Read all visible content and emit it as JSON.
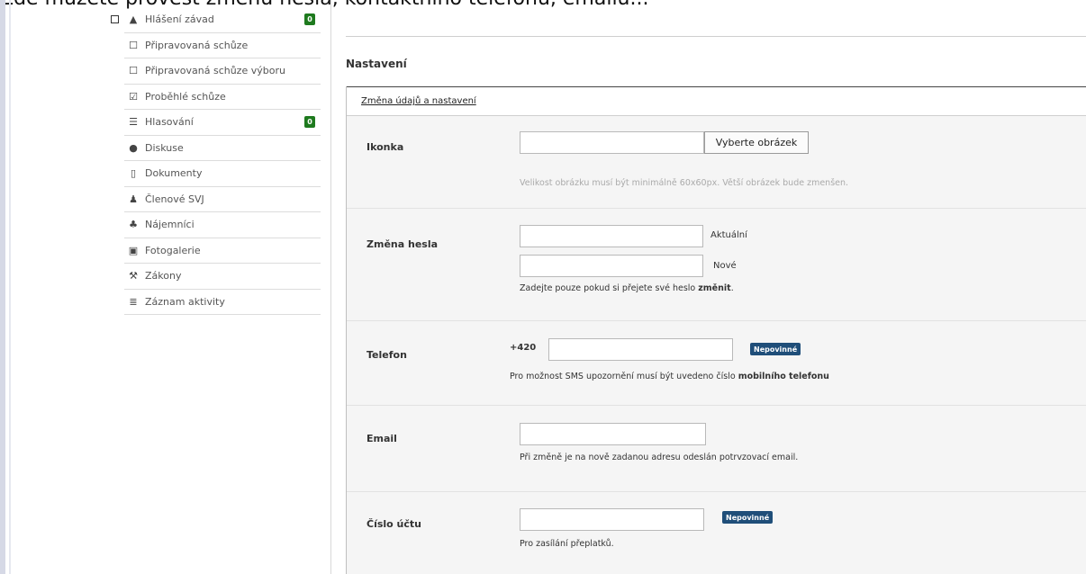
{
  "caption": "Zde můžete provést změnu hesla, kontaktního telefonu, emailu...",
  "sidebar": {
    "items": [
      {
        "label": "Hlášení závad",
        "icon": "warning-icon",
        "badge": "0"
      },
      {
        "label": "Připravovaná schůze",
        "icon": "checkbox-icon"
      },
      {
        "label": "Připravovaná schůze výboru",
        "icon": "checkbox-icon"
      },
      {
        "label": "Proběhlé schůze",
        "icon": "checked-checkbox-icon"
      },
      {
        "label": "Hlasování",
        "icon": "list-icon",
        "badge": "0"
      },
      {
        "label": "Diskuse",
        "icon": "chat-icon"
      },
      {
        "label": "Dokumenty",
        "icon": "document-icon"
      },
      {
        "label": "Členové SVJ",
        "icon": "user-icon"
      },
      {
        "label": "Nájemníci",
        "icon": "users-icon"
      },
      {
        "label": "Fotogalerie",
        "icon": "image-icon"
      },
      {
        "label": "Zákony",
        "icon": "gavel-icon"
      },
      {
        "label": "Záznam aktivity",
        "icon": "log-icon"
      }
    ],
    "badge_color": "#1e7a1e"
  },
  "page": {
    "title": "Nastavení",
    "panel_title": "Změna údajů a nastavení"
  },
  "form": {
    "icon": {
      "label": "Ikonka",
      "button": "Vyberte obrázek",
      "hint": "Velikost obrázku musí být minimálně 60x60px. Větší obrázek bude zmenšen."
    },
    "password": {
      "label": "Změna hesla",
      "current_label": "Aktuální",
      "new_label": "Nové",
      "hint_prefix": "Zadejte pouze pokud si přejete své heslo ",
      "hint_bold": "změnit",
      "hint_suffix": "."
    },
    "phone": {
      "label": "Telefon",
      "prefix": "+420",
      "badge": "Nepovinné",
      "hint_prefix": "Pro možnost SMS upozornění musí být uvedeno číslo ",
      "hint_bold": "mobilního telefonu"
    },
    "email": {
      "label": "Email",
      "hint": "Při změně je na nově zadanou adresu odeslán potrvzovací email."
    },
    "account": {
      "label": "Číslo účtu",
      "badge": "Nepovinné",
      "hint": "Pro zasílání přeplatků."
    },
    "optional_color": "#1f4e79"
  }
}
